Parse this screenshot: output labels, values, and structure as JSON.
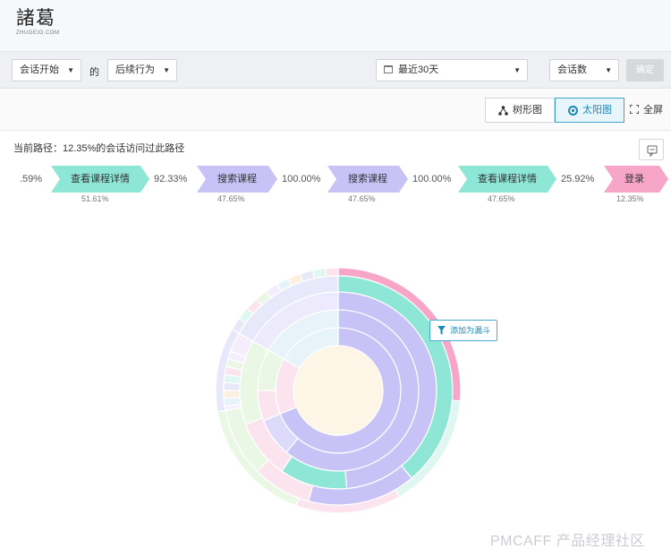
{
  "logo": {
    "main": "諸葛",
    "sub": "ZHUGEIO.COM"
  },
  "toolbar": {
    "start_event": "会话开始",
    "connector": "的",
    "behavior": "后续行为",
    "date_range": "最近30天",
    "metric": "会话数",
    "confirm_label": "确定"
  },
  "view": {
    "tree_label": "树形图",
    "sunburst_label": "太阳图",
    "fullscreen_label": "全屏"
  },
  "path_summary": "当前路径：12.35%的会话访问过此路径",
  "path": {
    "lead_pct": ".59%",
    "steps": [
      {
        "label": "查看课程详情",
        "sub": "51.61%",
        "color": "#8ee6d6"
      },
      {
        "label": "搜索课程",
        "sub": "47.65%",
        "color": "#c7c3f7"
      },
      {
        "label": "搜索课程",
        "sub": "47.65%",
        "color": "#c7c3f7"
      },
      {
        "label": "查看课程详情",
        "sub": "47.65%",
        "color": "#8ee6d6"
      },
      {
        "label": "登录",
        "sub": "12.35%",
        "color": "#f7a6c9"
      }
    ],
    "connectors": [
      "92.33%",
      "100.00%",
      "100.00%",
      "25.92%"
    ]
  },
  "tooltip": {
    "label": "添加为漏斗"
  },
  "watermark": "PMCAFF 产品经理社区",
  "colors": {
    "teal": "#8ee6d6",
    "lavender": "#c7c3f7",
    "pink": "#f7a6c9",
    "center": "#fdf6e6",
    "accent": "#1a88b8"
  }
}
